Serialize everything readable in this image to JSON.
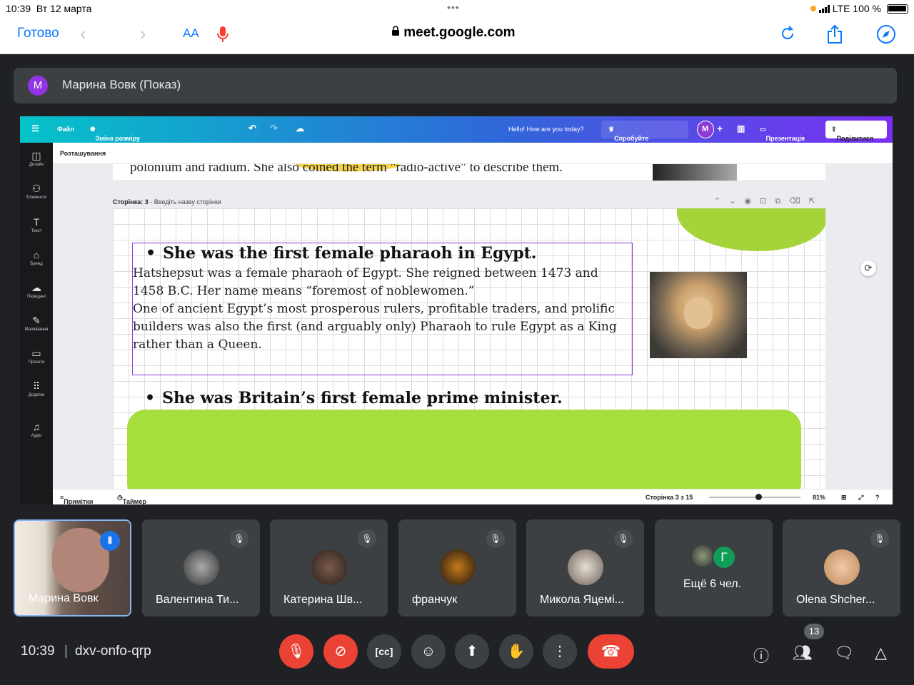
{
  "status_bar": {
    "time": "10:39",
    "date": "Вт 12 марта",
    "network": "LTE 100 %"
  },
  "safari": {
    "done_label": "Готово",
    "text_size_label": "AA",
    "url": "meet.google.com"
  },
  "presenter": {
    "avatar_letter": "M",
    "label": "Марина Вовк (Показ)"
  },
  "canva": {
    "menu": "Файл",
    "resize": "Зміна розміру й Магічне перетворення",
    "hello": "Hello! How are you today?",
    "try_pro": "Спробуйте Canva Pro",
    "user_initial": "M",
    "present": "Презентація",
    "share": "Поділитися",
    "sidebar": [
      "Дизайн",
      "Елементи",
      "Текст",
      "Бренд",
      "Передані",
      "Малювання",
      "Проєкти",
      "Додатки",
      "Аудіо"
    ],
    "sub_label": "Розташування",
    "prev_page_text": "polonium and radium. She also coined the term \"radio-active\" to describe them.",
    "page_label": "Сторінка: 3",
    "page_name_placeholder": "Введіть назву сторінки",
    "heading1": "She was the first female pharaoh in Egypt.",
    "paragraph1": "Hatshepsut was a female pharaoh of Egypt. She reigned between 1473 and 1458 B.C. Her name means “foremost of noblewomen.”",
    "paragraph2": "One of ancient Egypt’s most prosperous rulers, profitable traders, and prolific builders was also the first (and arguably only) Pharaoh to rule Egypt as a King rather than a Queen.",
    "heading2": "She was Britain’s first female prime minister.",
    "footer": {
      "notes": "Примітки",
      "timer": "Таймер",
      "page_count": "Сторінка 3 з 15",
      "zoom": "81%"
    }
  },
  "participants": [
    {
      "name": "Марина Вовк",
      "state": "speaking"
    },
    {
      "name": "Валентина Ти...",
      "state": "muted"
    },
    {
      "name": "Катерина Шв...",
      "state": "muted"
    },
    {
      "name": "франчук",
      "state": "muted"
    },
    {
      "name": "Микола Яцемі...",
      "state": "muted"
    },
    {
      "name": "Ещё 6 чел.",
      "avatar_letter": "Г"
    },
    {
      "name": "Olena Shcher...",
      "state": "muted"
    }
  ],
  "bottom": {
    "time": "10:39",
    "separator": "|",
    "meeting_code": "dxv-onfo-qrp",
    "people_count": "13"
  },
  "colors": {
    "meet_bg": "#202124",
    "tile_bg": "#3c4043",
    "end_call": "#ea4335",
    "speaking": "#1a73e8",
    "canva_purple": "#7b2ff2"
  }
}
